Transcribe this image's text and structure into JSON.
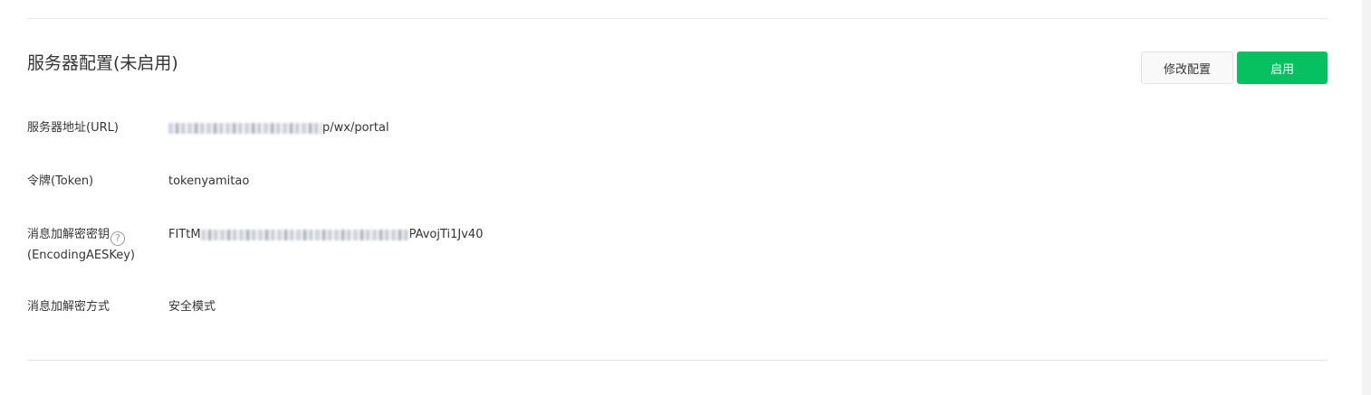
{
  "server_config": {
    "title": "服务器配置(未启用)",
    "modify_button": "修改配置",
    "enable_button": "启用",
    "url_label": "服务器地址(URL)",
    "url_value_suffix": "p/wx/portal",
    "token_label": "令牌(Token)",
    "token_value": "tokenyamitao",
    "aeskey_label_line1": "消息加解密密钥",
    "aeskey_label_line2": "(EncodingAESKey)",
    "aeskey_help_icon": "question-circle-icon",
    "aeskey_value_prefix": "FITtM",
    "aeskey_value_suffix": "PAvojTi1Jv40",
    "encrypt_mode_label": "消息加解密方式",
    "encrypt_mode_value": "安全模式"
  },
  "colors": {
    "primary_green": "#07c160",
    "text": "#353535",
    "divider": "#e7e7eb"
  }
}
